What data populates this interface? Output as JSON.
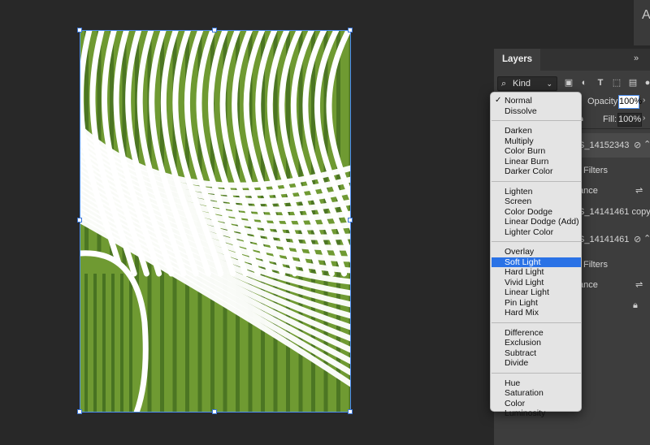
{
  "top_strip": {
    "glyph": "A"
  },
  "panel": {
    "tab": "Layers",
    "collapse": "»",
    "kind": {
      "label": "Kind",
      "icon": "magnifier-icon"
    },
    "filter_icons": [
      "image-filter-icon",
      "adjustment-filter-icon",
      "type-filter-icon",
      "shape-filter-icon",
      "smart-object-filter-icon"
    ],
    "opacity_label": "Opacity:",
    "opacity_value": "100%",
    "fill_label": "Fill:",
    "fill_value": "100%",
    "rows": {
      "layer1": "S_14152343",
      "filters1": "Filters",
      "adj1": "ance",
      "layer2": "S_14141461 copy",
      "layer3": "S_14141461",
      "filters2": "Filters",
      "adj2": "ance"
    }
  },
  "blend_menu": {
    "selected": "Soft Light",
    "checked": "Normal",
    "groups": [
      [
        "Normal",
        "Dissolve"
      ],
      [
        "Darken",
        "Multiply",
        "Color Burn",
        "Linear Burn",
        "Darker Color"
      ],
      [
        "Lighten",
        "Screen",
        "Color Dodge",
        "Linear Dodge (Add)",
        "Lighter Color"
      ],
      [
        "Overlay",
        "Soft Light",
        "Hard Light",
        "Vivid Light",
        "Linear Light",
        "Pin Light",
        "Hard Mix"
      ],
      [
        "Difference",
        "Exclusion",
        "Subtract",
        "Divide"
      ],
      [
        "Hue",
        "Saturation",
        "Color",
        "Luminosity"
      ]
    ]
  },
  "colors": {
    "workspace": "#282828",
    "panel": "#3d3d3d",
    "menu": "#e4e4e4",
    "highlight": "#2a72e6",
    "art_green": "#6f9a32",
    "art_dark": "#2f5a18",
    "stripe": "#ffffff"
  }
}
